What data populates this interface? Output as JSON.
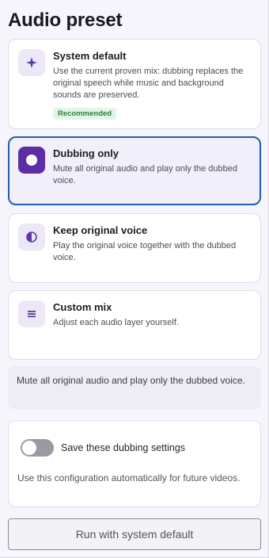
{
  "title": "Audio preset",
  "presets": [
    {
      "title": "System default",
      "description": "Use the current proven mix: dubbing replaces the original speech while music and background sounds are preserved.",
      "badge": "Recommended",
      "icon": "sparkle-icon",
      "selected": false
    },
    {
      "title": "Dubbing only",
      "description": "Mute all original audio and play only the dubbed voice.",
      "icon": "circle-dot-icon",
      "selected": true
    },
    {
      "title": "Keep original voice",
      "description": "Play the original voice together with the dubbed voice.",
      "icon": "half-circle-icon",
      "selected": false
    },
    {
      "title": "Custom mix",
      "description": "Adjust each audio layer yourself.",
      "icon": "lines-icon",
      "selected": false
    }
  ],
  "selection_info": "Mute all original audio and play only the dubbed voice.",
  "save_settings": {
    "label": "Save these dubbing settings",
    "description": "Use this configuration automatically for future videos.",
    "enabled": false
  },
  "run_button": "Run with system default",
  "colors": {
    "accent": "#5b2ea6",
    "selected_border": "#1f5fb0",
    "badge_bg": "#e3f5e6",
    "badge_text": "#2f7d3f"
  }
}
